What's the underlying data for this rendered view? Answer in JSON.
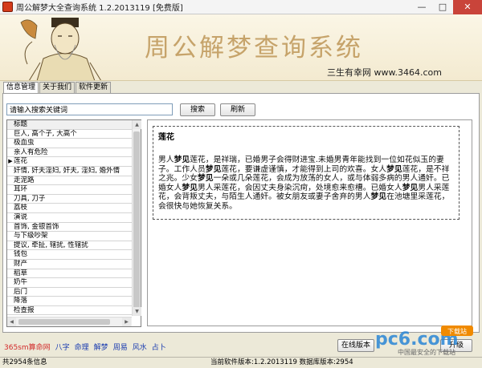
{
  "window": {
    "title": "周公解梦大全查询系统 1.2.2013119 [免费版]",
    "min_glyph": "—",
    "max_glyph": "□",
    "close_glyph": "✕"
  },
  "banner": {
    "title": "周公解梦查询系统",
    "subtitle": "三生有幸网  www.3464.com"
  },
  "tabs": [
    {
      "label": "信息管理"
    },
    {
      "label": "关于我们"
    },
    {
      "label": "软件更新"
    }
  ],
  "search": {
    "value": "请输入搜索关键词",
    "search_label": "搜索",
    "refresh_label": "刷新"
  },
  "list": {
    "header": "标题",
    "selected_marker": "▶",
    "items": [
      "巨人, 高个子, 大高个",
      "极血虫",
      "亲人有危险",
      "莲花",
      "奸情, 奸夫淫妇, 奸夫, 淫妇, 婚外情",
      "走泥路",
      "耳环",
      "刀具, 刀子",
      "荔枝",
      "演说",
      "首饰, 金银首饰",
      "与下级吵架",
      "提议, 牵扯, 辖扰, 性辖扰",
      "钱包",
      "财产",
      "稻草",
      "奶牛",
      "后门",
      "降落",
      "检查报"
    ],
    "arrow_up": "▲",
    "arrow_down": "▼",
    "arrow_left": "◀",
    "arrow_right": "▶"
  },
  "detail": {
    "title": "莲花",
    "body_html": "男人<b>梦见</b>莲花，是祥瑞，已婚男子会得财进宝.未婚男青年能找到一位如花似玉的妻子。工作人员<b>梦见</b>莲花，要谦虚谨慎，才能得到上司的欢喜。女人<b>梦见</b>莲花，是不祥之兆。少女<b>梦见</b>一朵或几朵莲花，会成为放荡的女人，或与体弱多病的男人通奸。已婚女人<b>梦见</b>男人采莲花，会因丈夫身染沉疴，处境愈来愈槽。已婚女人<b>梦见</b>男人采莲花，会背叛丈夫，与陌生人通奸。被女朋友或妻子舍弃的男人<b>梦见</b>在池塘里采莲花，会很快与她恢复关系。"
  },
  "footer": {
    "links": [
      "365sm算命网",
      "八字",
      "命理",
      "解梦",
      "周易",
      "风水",
      "占卜"
    ],
    "online_version_label": "在线版本",
    "upgrade_label": "升级"
  },
  "status": {
    "left": "共2954条信息",
    "middle": "当前软件版本:1.2.2013119 数据库版本:2954"
  },
  "watermark": {
    "text": "pc6.com",
    "tag": "下载站",
    "caption": "中国最安全的下载站"
  }
}
